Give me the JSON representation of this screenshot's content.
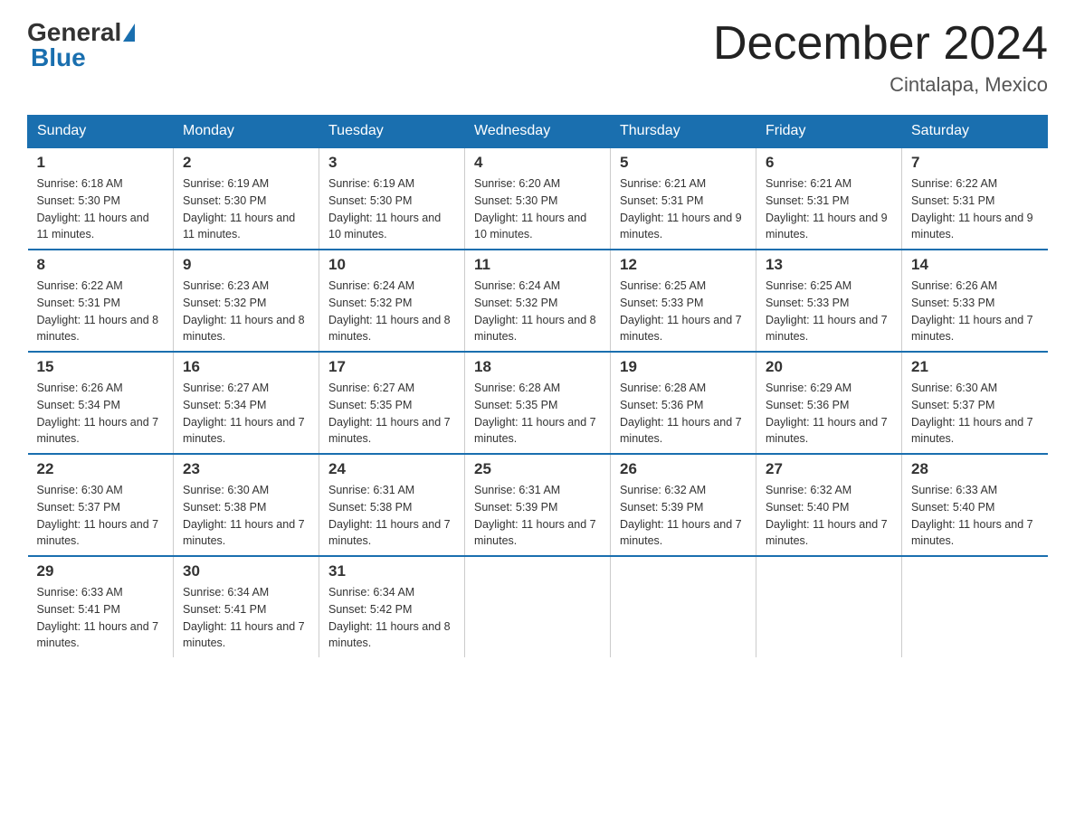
{
  "header": {
    "logo_general": "General",
    "logo_blue": "Blue",
    "month_title": "December 2024",
    "subtitle": "Cintalapa, Mexico"
  },
  "weekdays": [
    "Sunday",
    "Monday",
    "Tuesday",
    "Wednesday",
    "Thursday",
    "Friday",
    "Saturday"
  ],
  "weeks": [
    [
      {
        "day": "1",
        "sunrise": "6:18 AM",
        "sunset": "5:30 PM",
        "daylight": "11 hours and 11 minutes."
      },
      {
        "day": "2",
        "sunrise": "6:19 AM",
        "sunset": "5:30 PM",
        "daylight": "11 hours and 11 minutes."
      },
      {
        "day": "3",
        "sunrise": "6:19 AM",
        "sunset": "5:30 PM",
        "daylight": "11 hours and 10 minutes."
      },
      {
        "day": "4",
        "sunrise": "6:20 AM",
        "sunset": "5:30 PM",
        "daylight": "11 hours and 10 minutes."
      },
      {
        "day": "5",
        "sunrise": "6:21 AM",
        "sunset": "5:31 PM",
        "daylight": "11 hours and 9 minutes."
      },
      {
        "day": "6",
        "sunrise": "6:21 AM",
        "sunset": "5:31 PM",
        "daylight": "11 hours and 9 minutes."
      },
      {
        "day": "7",
        "sunrise": "6:22 AM",
        "sunset": "5:31 PM",
        "daylight": "11 hours and 9 minutes."
      }
    ],
    [
      {
        "day": "8",
        "sunrise": "6:22 AM",
        "sunset": "5:31 PM",
        "daylight": "11 hours and 8 minutes."
      },
      {
        "day": "9",
        "sunrise": "6:23 AM",
        "sunset": "5:32 PM",
        "daylight": "11 hours and 8 minutes."
      },
      {
        "day": "10",
        "sunrise": "6:24 AM",
        "sunset": "5:32 PM",
        "daylight": "11 hours and 8 minutes."
      },
      {
        "day": "11",
        "sunrise": "6:24 AM",
        "sunset": "5:32 PM",
        "daylight": "11 hours and 8 minutes."
      },
      {
        "day": "12",
        "sunrise": "6:25 AM",
        "sunset": "5:33 PM",
        "daylight": "11 hours and 7 minutes."
      },
      {
        "day": "13",
        "sunrise": "6:25 AM",
        "sunset": "5:33 PM",
        "daylight": "11 hours and 7 minutes."
      },
      {
        "day": "14",
        "sunrise": "6:26 AM",
        "sunset": "5:33 PM",
        "daylight": "11 hours and 7 minutes."
      }
    ],
    [
      {
        "day": "15",
        "sunrise": "6:26 AM",
        "sunset": "5:34 PM",
        "daylight": "11 hours and 7 minutes."
      },
      {
        "day": "16",
        "sunrise": "6:27 AM",
        "sunset": "5:34 PM",
        "daylight": "11 hours and 7 minutes."
      },
      {
        "day": "17",
        "sunrise": "6:27 AM",
        "sunset": "5:35 PM",
        "daylight": "11 hours and 7 minutes."
      },
      {
        "day": "18",
        "sunrise": "6:28 AM",
        "sunset": "5:35 PM",
        "daylight": "11 hours and 7 minutes."
      },
      {
        "day": "19",
        "sunrise": "6:28 AM",
        "sunset": "5:36 PM",
        "daylight": "11 hours and 7 minutes."
      },
      {
        "day": "20",
        "sunrise": "6:29 AM",
        "sunset": "5:36 PM",
        "daylight": "11 hours and 7 minutes."
      },
      {
        "day": "21",
        "sunrise": "6:30 AM",
        "sunset": "5:37 PM",
        "daylight": "11 hours and 7 minutes."
      }
    ],
    [
      {
        "day": "22",
        "sunrise": "6:30 AM",
        "sunset": "5:37 PM",
        "daylight": "11 hours and 7 minutes."
      },
      {
        "day": "23",
        "sunrise": "6:30 AM",
        "sunset": "5:38 PM",
        "daylight": "11 hours and 7 minutes."
      },
      {
        "day": "24",
        "sunrise": "6:31 AM",
        "sunset": "5:38 PM",
        "daylight": "11 hours and 7 minutes."
      },
      {
        "day": "25",
        "sunrise": "6:31 AM",
        "sunset": "5:39 PM",
        "daylight": "11 hours and 7 minutes."
      },
      {
        "day": "26",
        "sunrise": "6:32 AM",
        "sunset": "5:39 PM",
        "daylight": "11 hours and 7 minutes."
      },
      {
        "day": "27",
        "sunrise": "6:32 AM",
        "sunset": "5:40 PM",
        "daylight": "11 hours and 7 minutes."
      },
      {
        "day": "28",
        "sunrise": "6:33 AM",
        "sunset": "5:40 PM",
        "daylight": "11 hours and 7 minutes."
      }
    ],
    [
      {
        "day": "29",
        "sunrise": "6:33 AM",
        "sunset": "5:41 PM",
        "daylight": "11 hours and 7 minutes."
      },
      {
        "day": "30",
        "sunrise": "6:34 AM",
        "sunset": "5:41 PM",
        "daylight": "11 hours and 7 minutes."
      },
      {
        "day": "31",
        "sunrise": "6:34 AM",
        "sunset": "5:42 PM",
        "daylight": "11 hours and 8 minutes."
      },
      null,
      null,
      null,
      null
    ]
  ],
  "labels": {
    "sunrise": "Sunrise:",
    "sunset": "Sunset:",
    "daylight": "Daylight:"
  }
}
